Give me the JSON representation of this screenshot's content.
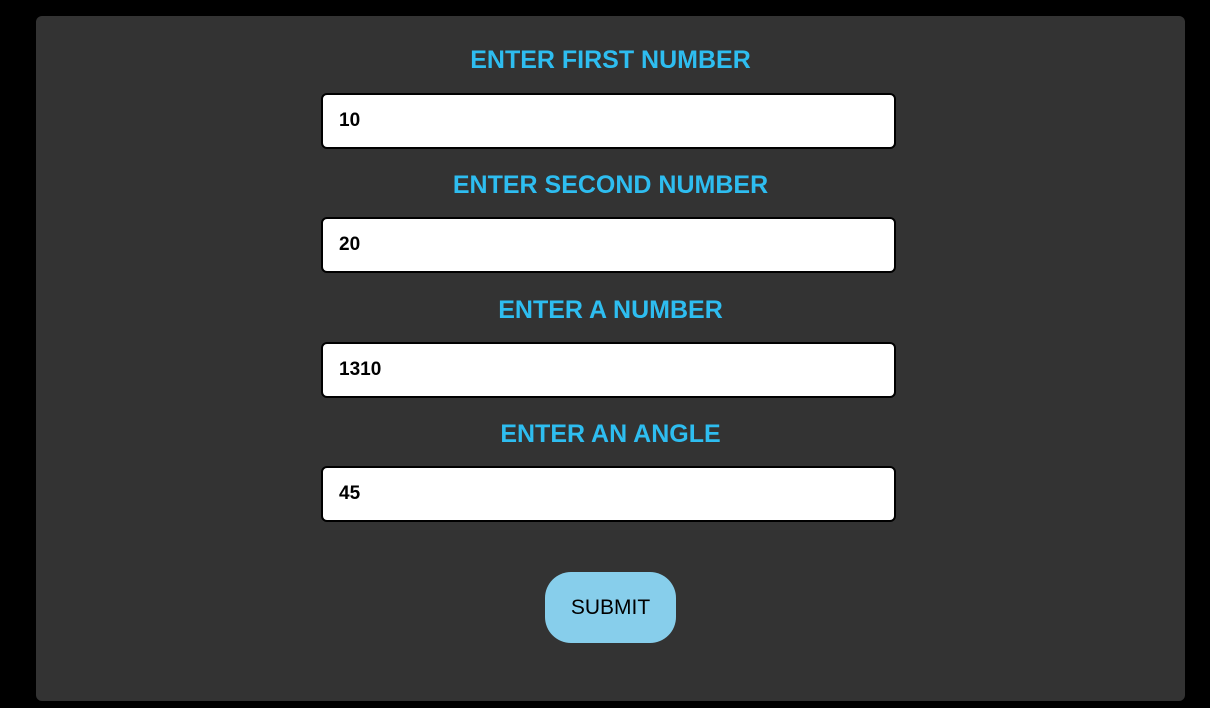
{
  "form": {
    "fields": [
      {
        "label": "ENTER FIRST NUMBER",
        "value": "10"
      },
      {
        "label": "ENTER SECOND NUMBER",
        "value": "20"
      },
      {
        "label": "ENTER A NUMBER",
        "value": "1310"
      },
      {
        "label": "ENTER AN ANGLE",
        "value": "45"
      }
    ],
    "submit_label": "SUBMIT"
  },
  "colors": {
    "background": "#000000",
    "panel": "#333333",
    "label": "#2ebdf0",
    "button": "#87ceeb"
  }
}
